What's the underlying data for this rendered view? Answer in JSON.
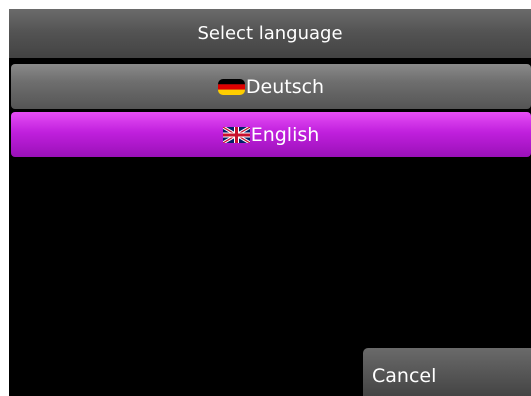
{
  "dialog": {
    "title": "Select language"
  },
  "languages": [
    {
      "label": "Deutsch",
      "flag_icon": "german-flag-icon",
      "selected": false
    },
    {
      "label": "English",
      "flag_icon": "uk-flag-icon",
      "selected": true
    }
  ],
  "actions": {
    "cancel_label": "Cancel"
  },
  "colors": {
    "selected_accent": "#c020dd",
    "button_gray": "#6e6e6e",
    "background": "#000000"
  }
}
